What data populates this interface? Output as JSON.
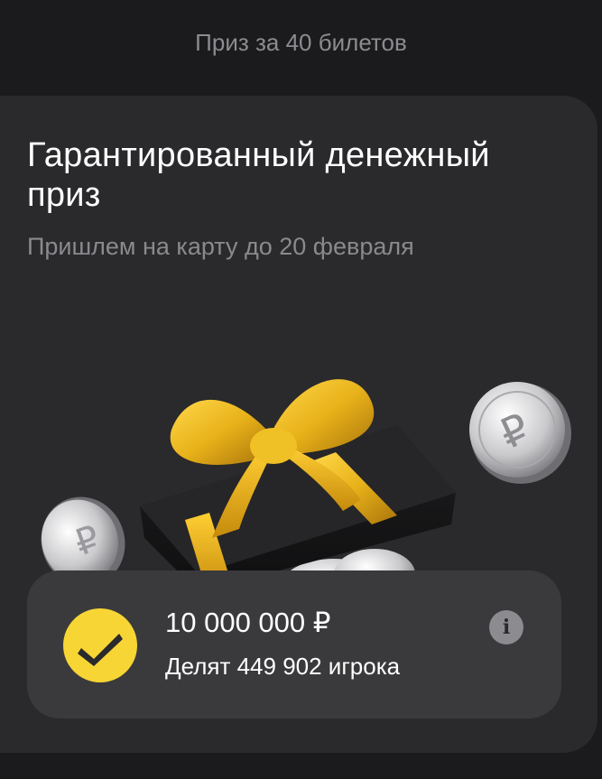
{
  "header": {
    "title": "Приз за 40 билетов"
  },
  "card": {
    "title": "Гарантированный денежный приз",
    "subtitle": "Пришлем на карту до 20 февраля",
    "illustration": {
      "icon": "gift-box-with-coins-illustration"
    },
    "prize": {
      "amount": "10 000 000 ₽",
      "share_text": "Делят 449 902 игрока",
      "badge_icon": "checkmark-icon",
      "info_icon": "info-icon",
      "info_glyph": "i"
    }
  },
  "colors": {
    "background": "#1b1b1d",
    "card": "#2a2a2c",
    "panel": "#3a3a3c",
    "accent_yellow": "#f7d534",
    "ribbon_gold": "#e8b21a",
    "muted_text": "#8a8a8e"
  }
}
